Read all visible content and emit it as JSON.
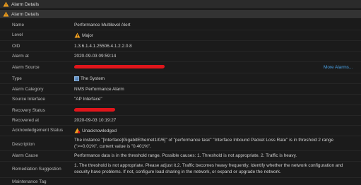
{
  "window": {
    "title": "Alarm Details"
  },
  "panel": {
    "title": "Alarm Details"
  },
  "rows": {
    "name": {
      "label": "Name",
      "value": "Performance Multilevel Alert"
    },
    "level": {
      "label": "Level",
      "value": "Major"
    },
    "oid": {
      "label": "OID",
      "value": "1.3.6.1.4.1.25506.4.1.2.2.0.8"
    },
    "alarm_at": {
      "label": "Alarm at",
      "value": "2020-09-03 09:59:14"
    },
    "alarm_source": {
      "label": "Alarm Source",
      "more": "More Alarms..."
    },
    "type": {
      "label": "Type",
      "value": "The System"
    },
    "category": {
      "label": "Alarm Category",
      "value": "NMS Performance Alarm"
    },
    "source_interface": {
      "label": "Source Interface",
      "value": "\"AP Interface\""
    },
    "recovery_status": {
      "label": "Recovery Status"
    },
    "recovered_at": {
      "label": "Recovered at",
      "value": "2020-09-03 10:19:27"
    },
    "ack_status": {
      "label": "Acknowledgement Status",
      "value": "Unacknowledged"
    },
    "description": {
      "label": "Description",
      "value": "The instance \"[Interface]GigabitEthernet1/0/6]\" of \"performance task\" \"Interface Inbound Packet Loss Rate\" is in threshold 2 range (\">=0.01%\", current value is \"0.401%\"."
    },
    "cause": {
      "label": "Alarm Cause",
      "value": "Performance data is in the threshold range. Possible causes: 1. Threshold is not appropriate. 2. Traffic is heavy."
    },
    "remediation": {
      "label": "Remediation Suggestion",
      "value": "1. The threshold is not appropriate. Please adjust it.2. Traffic becomes heavy frequently. Identify whether the network configuration and security have problems. If not, configure load sharing in the network, or expand or upgrade the network."
    },
    "maintenance": {
      "label": "Maintenance Tag"
    }
  },
  "colors": {
    "link": "#4aa3e8",
    "redaction": "#e0151b",
    "warning": "#f0a020"
  }
}
